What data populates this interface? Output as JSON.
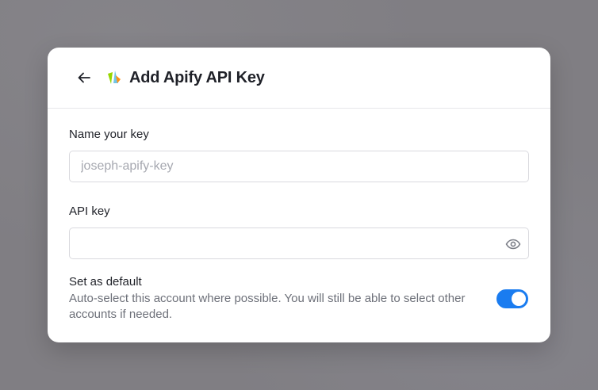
{
  "dialog": {
    "title": "Add Apify API Key",
    "back_icon": "arrow-left-icon",
    "logo_icon": "apify-logo"
  },
  "name_field": {
    "label": "Name your key",
    "value": "",
    "placeholder": "joseph-apify-key"
  },
  "api_key_field": {
    "label": "API key",
    "value": "",
    "placeholder": "",
    "visibility_icon": "eye-icon"
  },
  "default_setting": {
    "title": "Set as default",
    "description": "Auto-select this account where possible. You will still be able to select other accounts if needed.",
    "enabled": true,
    "toggle_color": "#1a7cf0"
  }
}
